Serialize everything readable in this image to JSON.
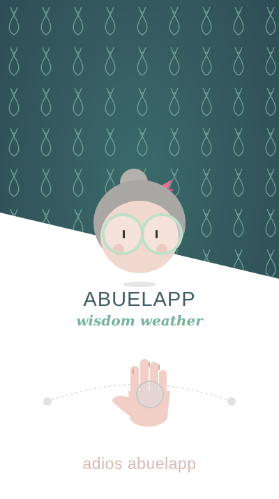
{
  "app": {
    "title": "ABUELAPP",
    "subtitle": "wisdom weather"
  },
  "footer": {
    "text": "adios abuelapp"
  },
  "colors": {
    "header_bg_dark": "#2f4f55",
    "header_bg_light": "#3b6a69",
    "pattern": "#7fb8a6",
    "title": "#3f5b66",
    "subtitle": "#74b49a",
    "footer": "#d9b9b3",
    "hand": "#f2cfc6"
  },
  "icons": {
    "avatar": "grandma-face-icon",
    "hand": "hand-icon",
    "pattern": "ribbon-pattern-icon"
  }
}
